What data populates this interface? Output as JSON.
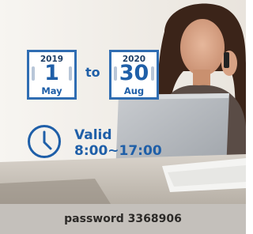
{
  "promo": {
    "from": {
      "year": "2019",
      "day": "1",
      "month": "May"
    },
    "connector": "to",
    "until": {
      "year": "2020",
      "day": "30",
      "month": "Aug"
    },
    "valid": {
      "label": "Valid",
      "hours": "8:00~17:00"
    },
    "password_text": "password 3368906"
  },
  "icons": {
    "clock": "clock-icon",
    "calendar": "calendar-icon"
  },
  "colors": {
    "accent": "#1f5fa8",
    "band": "#c4c0bb"
  }
}
